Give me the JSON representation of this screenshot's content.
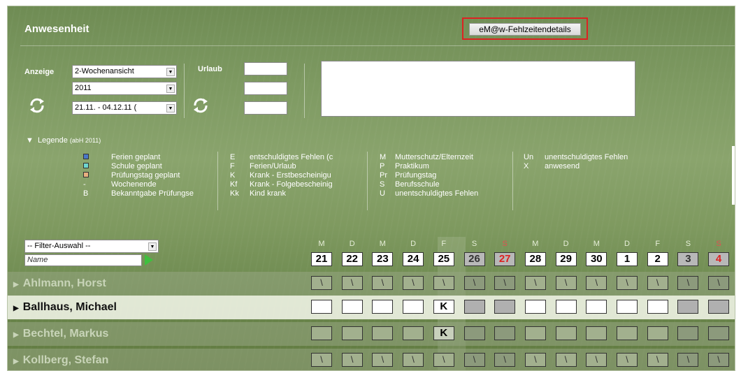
{
  "window": {
    "title": "Anwesenheit",
    "button_label": "eM@w-Fehlzeitendetails"
  },
  "controls": {
    "anzeige_label": "Anzeige",
    "view_value": "2-Wochenansicht",
    "year_value": "2011",
    "range_value": "21.11. - 04.12.11 (",
    "urlaub_label": "Urlaub",
    "refresh_icon": "refresh-icon"
  },
  "legend": {
    "header": "Legende",
    "header_sub": "(abH 2011)",
    "col1": [
      {
        "code": "",
        "label": "Ferien geplant",
        "color": "#4a78c8"
      },
      {
        "code": "",
        "label": "Schule geplant",
        "color": "#6fd6d0"
      },
      {
        "code": "",
        "label": "Prüfungstag geplant",
        "color": "#e8b080"
      },
      {
        "code": "-",
        "label": "Wochenende"
      },
      {
        "code": "B",
        "label": "Bekanntgabe Prüfungse"
      }
    ],
    "col2": [
      {
        "code": "E",
        "label": "entschuldigtes Fehlen (c"
      },
      {
        "code": "F",
        "label": "Ferien/Urlaub"
      },
      {
        "code": "K",
        "label": "Krank - Erstbescheinigu"
      },
      {
        "code": "Kf",
        "label": "Krank - Folgebescheinig"
      },
      {
        "code": "Kk",
        "label": "Kind krank"
      }
    ],
    "col3": [
      {
        "code": "M",
        "label": "Mutterschutz/Elternzeit"
      },
      {
        "code": "P",
        "label": "Praktikum"
      },
      {
        "code": "Pr",
        "label": "Prüfungstag"
      },
      {
        "code": "S",
        "label": "Berufsschule"
      },
      {
        "code": "U",
        "label": "unentschuldigtes Fehlen"
      }
    ],
    "col4": [
      {
        "code": "Un",
        "label": "unentschuldigtes Fehlen"
      },
      {
        "code": "X",
        "label": "anwesend"
      }
    ]
  },
  "filter": {
    "select_value": "-- Filter-Auswahl --",
    "name_placeholder": "Name"
  },
  "days": [
    {
      "letter": "M",
      "num": "21",
      "weekend": false,
      "red": false
    },
    {
      "letter": "D",
      "num": "22",
      "weekend": false,
      "red": false
    },
    {
      "letter": "M",
      "num": "23",
      "weekend": false,
      "red": false
    },
    {
      "letter": "D",
      "num": "24",
      "weekend": false,
      "red": false
    },
    {
      "letter": "F",
      "num": "25",
      "weekend": false,
      "red": false
    },
    {
      "letter": "S",
      "num": "26",
      "weekend": true,
      "red": false
    },
    {
      "letter": "S",
      "num": "27",
      "weekend": true,
      "red": true
    },
    {
      "letter": "M",
      "num": "28",
      "weekend": false,
      "red": false
    },
    {
      "letter": "D",
      "num": "29",
      "weekend": false,
      "red": false
    },
    {
      "letter": "M",
      "num": "30",
      "weekend": false,
      "red": false
    },
    {
      "letter": "D",
      "num": "1",
      "weekend": false,
      "red": false
    },
    {
      "letter": "F",
      "num": "2",
      "weekend": false,
      "red": false
    },
    {
      "letter": "S",
      "num": "3",
      "weekend": true,
      "red": false
    },
    {
      "letter": "S",
      "num": "4",
      "weekend": true,
      "red": true
    }
  ],
  "people": [
    {
      "name": "Ahlmann, Horst",
      "active": false,
      "marks": [
        "\\",
        "\\",
        "\\",
        "\\",
        "\\",
        "\\",
        "\\",
        "\\",
        "\\",
        "\\",
        "\\",
        "\\",
        "\\",
        "\\"
      ]
    },
    {
      "name": "Ballhaus, Michael",
      "active": true,
      "marks": [
        "",
        "",
        "",
        "",
        "K",
        "",
        "",
        "",
        "",
        "",
        "",
        "",
        "",
        ""
      ]
    },
    {
      "name": "Bechtel, Markus",
      "active": false,
      "marks": [
        "",
        "",
        "",
        "",
        "K",
        "",
        "",
        "",
        "",
        "",
        "",
        "",
        "",
        ""
      ]
    },
    {
      "name": "Kollberg, Stefan",
      "active": false,
      "marks": [
        "\\",
        "\\",
        "\\",
        "\\",
        "\\",
        "\\",
        "\\",
        "\\",
        "\\",
        "\\",
        "\\",
        "\\",
        "\\",
        "\\"
      ]
    }
  ]
}
